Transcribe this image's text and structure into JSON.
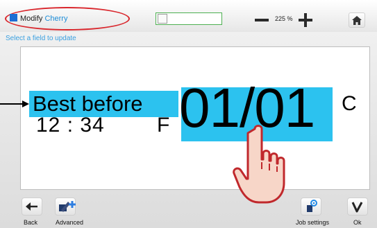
{
  "header": {
    "title_prefix": "Modify",
    "title_name": "Cherry",
    "zoom_value": "225 %"
  },
  "subtitle": "Select a field to update",
  "canvas": {
    "best_before_label": "Best before",
    "time_text": "12 : 34",
    "f_letter": "F",
    "date_text": "01/01",
    "c_letter": "C"
  },
  "footer": {
    "back_label": "Back",
    "advanced_label": "Advanced",
    "job_settings_label": "Job settings",
    "ok_label": "Ok"
  },
  "colors": {
    "field_highlight": "#2cc2ef",
    "title_accent": "#1c8dd8",
    "annotation_red": "#d9262c",
    "progress_green": "#4caf50"
  },
  "icons": [
    "home-icon",
    "zoom-minus-icon",
    "zoom-plus-icon",
    "back-arrow-icon",
    "advanced-edit-icon",
    "job-settings-icon",
    "ok-check-icon",
    "pointer-hand-icon",
    "annotation-arrow-icon"
  ]
}
